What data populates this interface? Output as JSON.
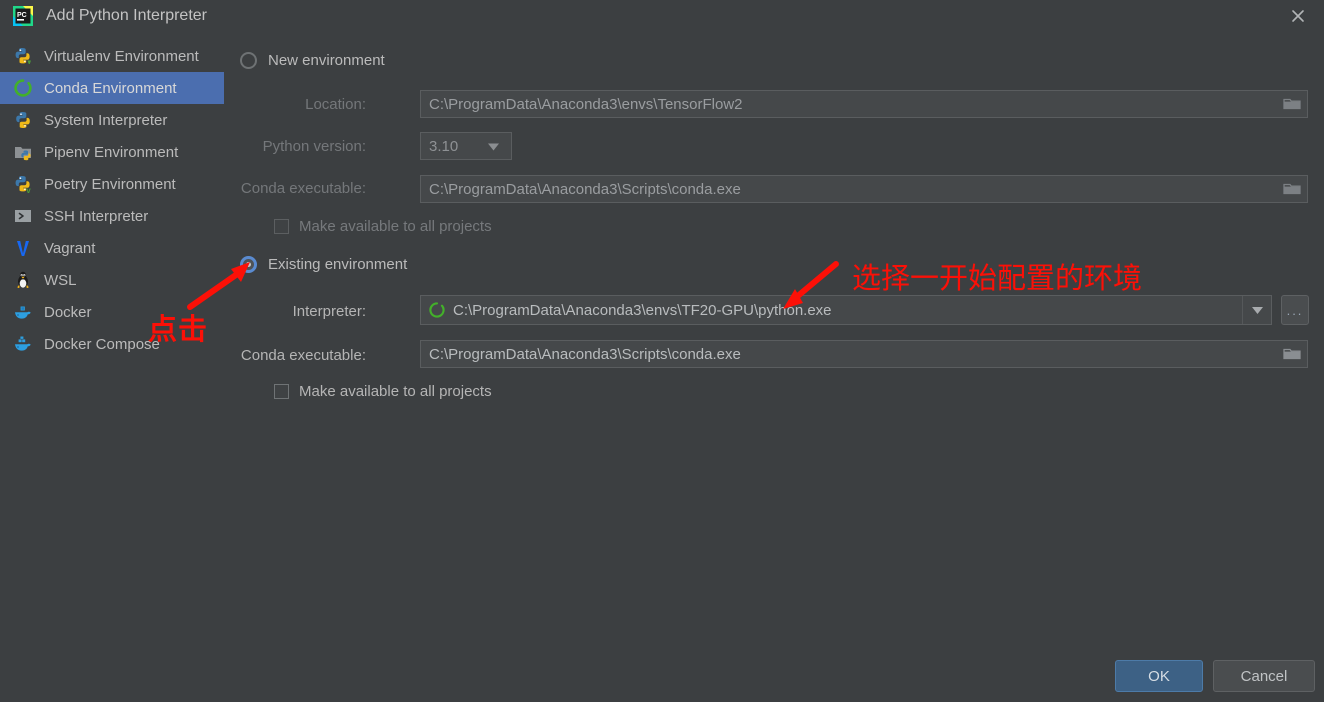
{
  "window": {
    "title": "Add Python Interpreter",
    "app_icon": "pycharm-icon",
    "close_icon": "close-icon"
  },
  "sidebar": {
    "items": [
      {
        "label": "Virtualenv Environment",
        "icon": "python-venv-icon",
        "selected": false
      },
      {
        "label": "Conda Environment",
        "icon": "conda-icon",
        "selected": true
      },
      {
        "label": "System Interpreter",
        "icon": "python-icon",
        "selected": false
      },
      {
        "label": "Pipenv Environment",
        "icon": "pipenv-icon",
        "selected": false
      },
      {
        "label": "Poetry Environment",
        "icon": "poetry-icon",
        "selected": false
      },
      {
        "label": "SSH Interpreter",
        "icon": "ssh-terminal-icon",
        "selected": false
      },
      {
        "label": "Vagrant",
        "icon": "vagrant-icon",
        "selected": false
      },
      {
        "label": "WSL",
        "icon": "linux-penguin-icon",
        "selected": false
      },
      {
        "label": "Docker",
        "icon": "docker-icon",
        "selected": false
      },
      {
        "label": "Docker Compose",
        "icon": "docker-compose-icon",
        "selected": false
      }
    ]
  },
  "new_environment": {
    "radio_label": "New environment",
    "selected": false,
    "location": {
      "label": "Location:",
      "value": "C:\\ProgramData\\Anaconda3\\envs\\TensorFlow2",
      "browse_icon": "folder-icon"
    },
    "python_version": {
      "label": "Python version:",
      "value": "3.10",
      "arrow_icon": "chevron-down-icon"
    },
    "conda_executable": {
      "label": "Conda executable:",
      "value": "C:\\ProgramData\\Anaconda3\\Scripts\\conda.exe",
      "browse_icon": "folder-icon"
    },
    "make_available": {
      "label": "Make available to all projects",
      "checked": false
    }
  },
  "existing_environment": {
    "radio_label": "Existing environment",
    "selected": true,
    "interpreter": {
      "label": "Interpreter:",
      "value": "C:\\ProgramData\\Anaconda3\\envs\\TF20-GPU\\python.exe",
      "item_icon": "conda-icon",
      "arrow_icon": "chevron-down-icon",
      "more_button_label": "...",
      "more_button_icon": "ellipsis-icon"
    },
    "conda_executable": {
      "label": "Conda executable:",
      "value": "C:\\ProgramData\\Anaconda3\\Scripts\\conda.exe",
      "browse_icon": "folder-icon"
    },
    "make_available": {
      "label": "Make available to all projects",
      "checked": false
    }
  },
  "footer": {
    "ok_label": "OK",
    "cancel_label": "Cancel"
  },
  "annotations": {
    "click_note": "点击",
    "select_note": "选择一开始配置的环境",
    "color": "#fc1007",
    "arrow_click_icon": "red-arrow-icon",
    "arrow_select_icon": "red-arrow-icon"
  },
  "colors": {
    "background": "#3c3f41",
    "selection": "#4b6eaf",
    "accent_ok": "#3d6185",
    "conda_green": "#43b02a",
    "annotation_red": "#fc1007"
  }
}
